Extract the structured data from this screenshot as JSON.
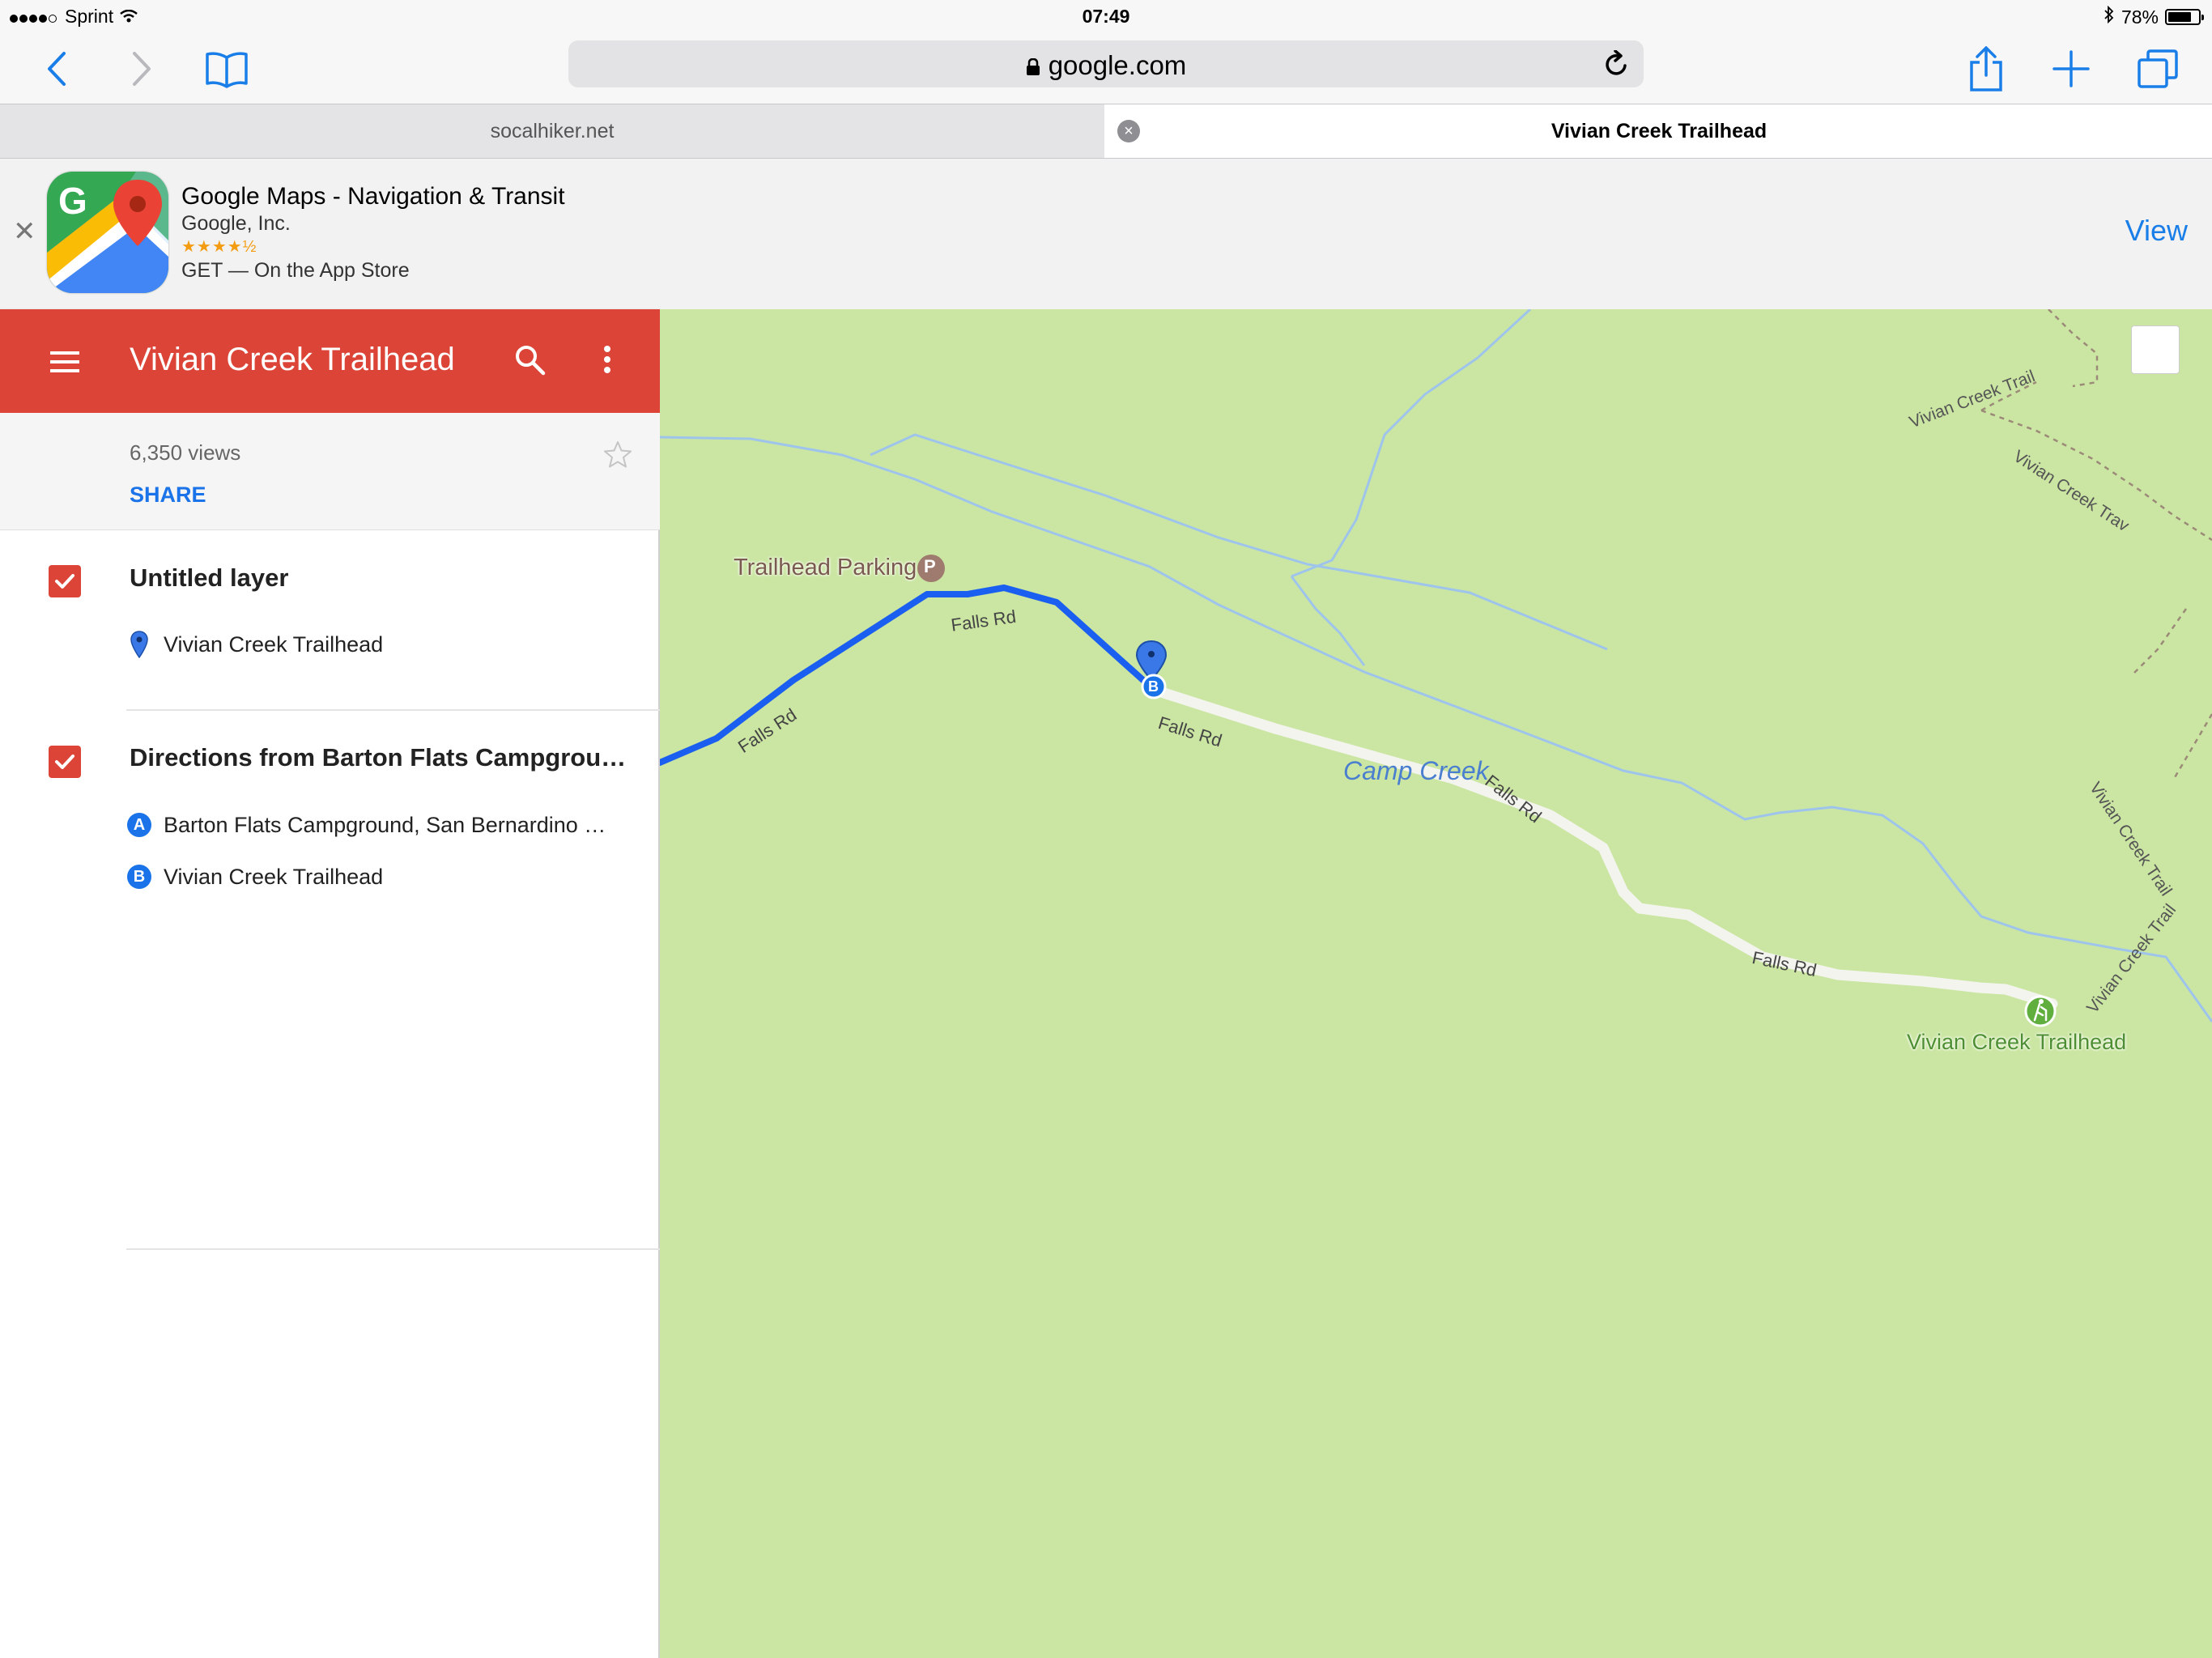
{
  "status": {
    "carrier": "Sprint",
    "time": "07:49",
    "battery": "78%",
    "battery_level": 0.78
  },
  "toolbar": {
    "url": "google.com"
  },
  "tabs": [
    {
      "label": "socalhiker.net"
    },
    {
      "label": "Vivian Creek Trailhead"
    }
  ],
  "banner": {
    "app_name": "Google Maps - Navigation & Transit",
    "developer": "Google, Inc.",
    "stars": "★★★★½",
    "rating": 4.5,
    "get_text": "GET — On the App Store",
    "view_label": "View"
  },
  "panel": {
    "title": "Vivian Creek Trailhead",
    "views": "6,350 views",
    "share_label": "SHARE",
    "layers": [
      {
        "title": "Untitled layer",
        "items": [
          {
            "icon": "map-pin-icon",
            "label": "Vivian Creek Trailhead"
          }
        ]
      },
      {
        "title": "Directions from Barton Flats Campgrou…",
        "items": [
          {
            "badge": "A",
            "label": "Barton Flats Campground, San Bernardino …"
          },
          {
            "badge": "B",
            "label": "Vivian Creek Trailhead"
          }
        ]
      }
    ]
  },
  "map": {
    "labels": {
      "trailhead_parking": "Trailhead Parking",
      "parking_badge": "P",
      "camp_creek": "Camp Creek",
      "falls_rd": "Falls Rd",
      "vivian_creek_trail": "Vivian Creek Trail",
      "vivian_creek_trav": "Vivian Creek Trav",
      "vivian_creek_trailhead": "Vivian Creek Trailhead",
      "marker_badge": "B"
    },
    "colors": {
      "land": "#cbe6a3",
      "water": "#9ec4ec",
      "route": "#1a5ff0",
      "road": "#f4f4ef",
      "trail": "#9b8a77"
    }
  },
  "colors": {
    "accent": "#db4437",
    "link": "#1a73e8",
    "ios_blue": "#1a7ee8"
  }
}
